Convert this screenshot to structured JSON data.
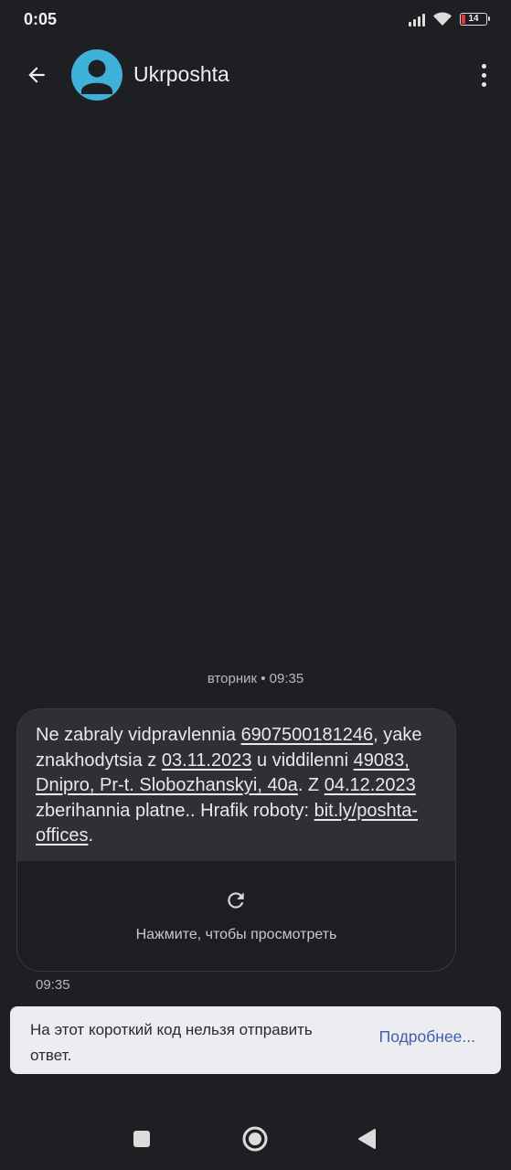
{
  "status_bar": {
    "time": "0:05",
    "battery": "14",
    "battery_level": 0.14,
    "icons": [
      "signal-icon",
      "wifi-icon",
      "battery-icon"
    ]
  },
  "app_bar": {
    "contact_name": "Ukrposhta",
    "back_icon": "arrow-left-icon",
    "menu_icon": "more-vert-icon",
    "avatar_color": "#3fb2da"
  },
  "conversation": {
    "date_divider": "вторник • 09:35",
    "message": {
      "segments": [
        {
          "text": "Ne zabraly vidpravlennia ",
          "link": false
        },
        {
          "text": "6907500181246",
          "link": true
        },
        {
          "text": ", yake znakhodytsia z ",
          "link": false
        },
        {
          "text": "03.11.2023",
          "link": true
        },
        {
          "text": " u viddilenni ",
          "link": false
        },
        {
          "text": "49083, Dnipro, Pr-t. Slobozhanskyi, 40a",
          "link": true
        },
        {
          "text": ". Z ",
          "link": false
        },
        {
          "text": "04.12.2023",
          "link": true
        },
        {
          "text": " zberihannia platne.. Hrafik roboty: ",
          "link": false
        },
        {
          "text": "bit.ly/poshta-offices",
          "link": true
        },
        {
          "text": ".",
          "link": false
        }
      ],
      "preview_label": "Нажмите, чтобы просмотреть",
      "time": "09:35"
    }
  },
  "notice": {
    "text": "На этот короткий код нельзя отправить ответ.",
    "link_label": "Подробнее..."
  },
  "colors": {
    "background": "#1e1f23",
    "bubble": "#2f3034",
    "accent_link": "#3e5fae",
    "battery_low": "#e53935"
  }
}
